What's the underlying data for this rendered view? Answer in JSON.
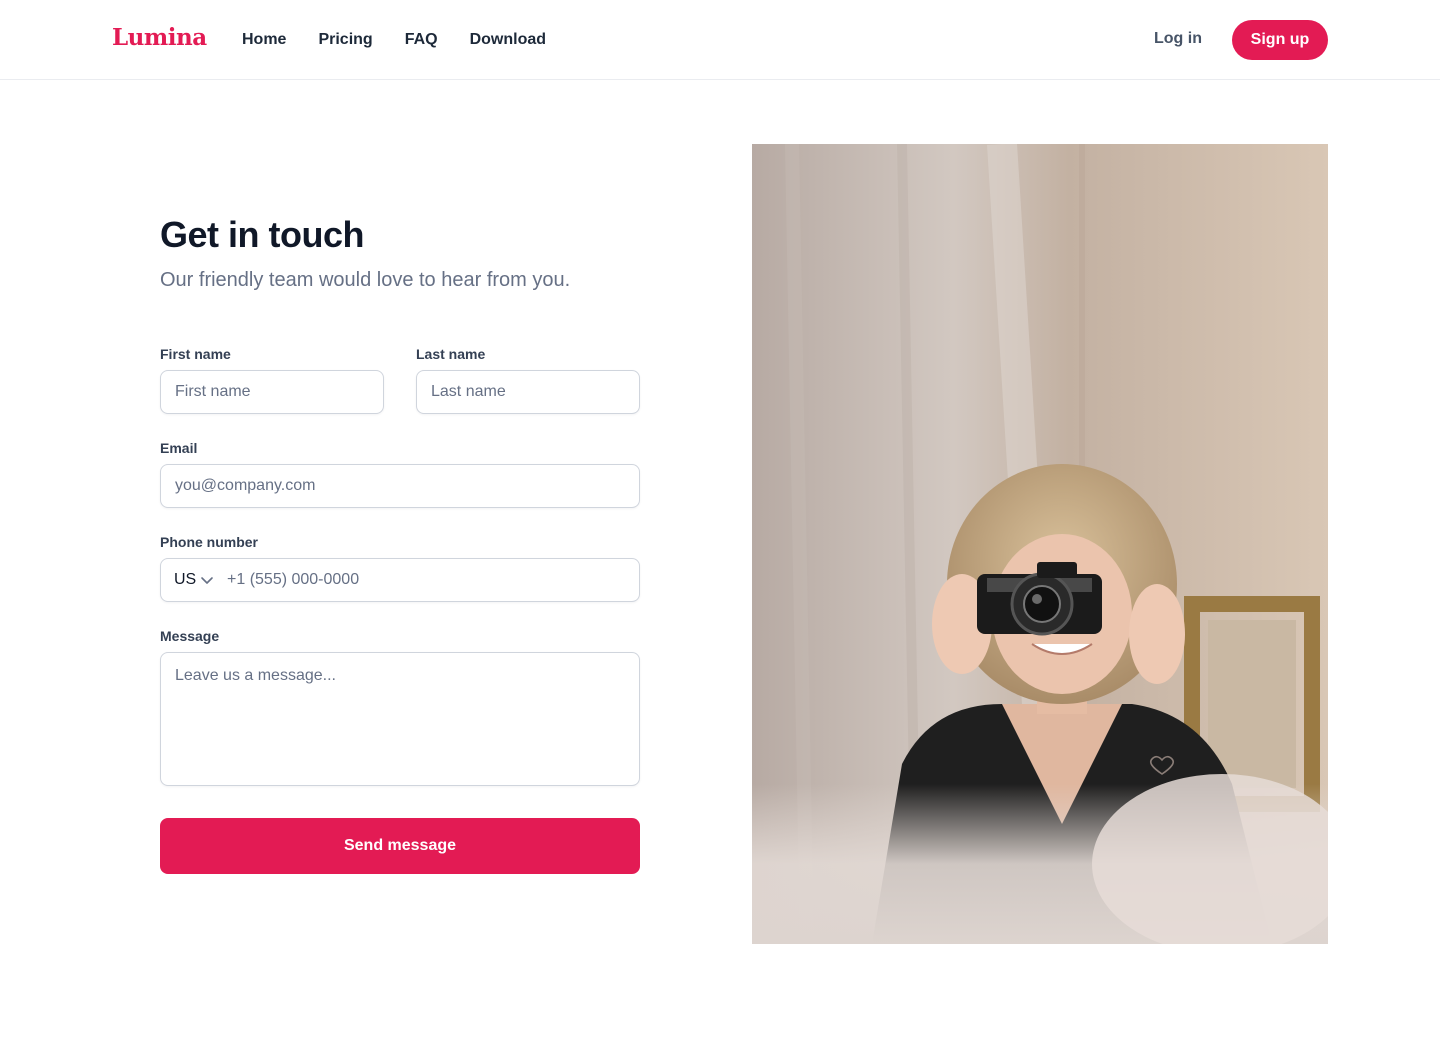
{
  "brand": {
    "name": "Lumina",
    "accent": "#e31b54"
  },
  "nav": {
    "items": [
      {
        "label": "Home"
      },
      {
        "label": "Pricing"
      },
      {
        "label": "FAQ"
      },
      {
        "label": "Download"
      }
    ],
    "login_label": "Log in",
    "signup_label": "Sign up"
  },
  "contact": {
    "title": "Get in touch",
    "subtitle": "Our friendly team would love to hear from you.",
    "first_name": {
      "label": "First name",
      "placeholder": "First name",
      "value": ""
    },
    "last_name": {
      "label": "Last name",
      "placeholder": "Last name",
      "value": ""
    },
    "email": {
      "label": "Email",
      "placeholder": "you@company.com",
      "value": ""
    },
    "phone": {
      "label": "Phone number",
      "country": "US",
      "placeholder": "+1 (555) 000-0000",
      "value": ""
    },
    "message": {
      "label": "Message",
      "placeholder": "Leave us a message...",
      "value": ""
    },
    "submit_label": "Send message"
  },
  "photo": {
    "subject": "woman-with-camera-photo",
    "icons": [
      "heart-icon"
    ]
  }
}
